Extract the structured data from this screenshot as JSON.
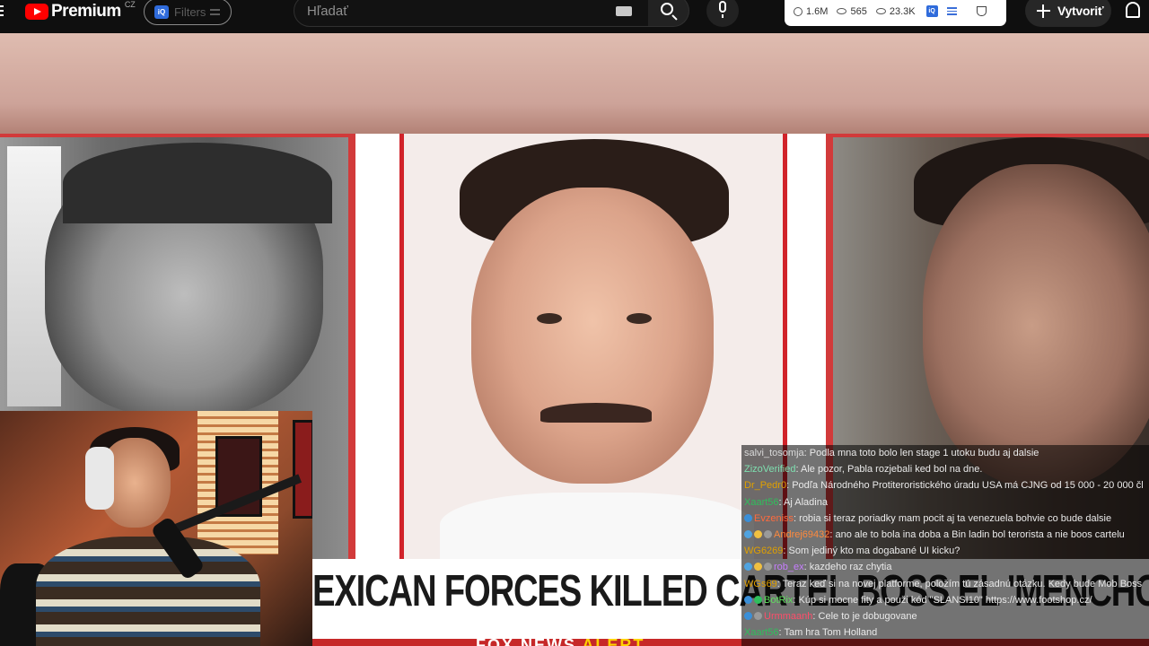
{
  "header": {
    "logo_text": "Premium",
    "logo_country": "CZ",
    "filters_badge": "iQ",
    "filters_label": "Filters",
    "search_placeholder": "Hľadať",
    "stats": {
      "subscribers": "1.6M",
      "views_a": "565",
      "views_b": "23.3K",
      "iq_badge": "iQ"
    },
    "create_label": "Vytvoriť"
  },
  "video": {
    "headline": "EXICAN FORCES KILLED CARTEL BOSS EL 'MENCHO'",
    "breaking_prefix": "FOX NEWS ",
    "breaking_suffix": "ALERT"
  },
  "chat": {
    "messages": [
      {
        "user": "salvi_tosomja",
        "color": "#d8d8d8",
        "text": "Podla mna toto bolo len stage 1 utoku budu aj dalsie",
        "badges": []
      },
      {
        "user": "ZizoVerified",
        "color": "#7ee0b0",
        "text": "Ale pozor, Pabla rozjebali ked bol na dne.",
        "badges": []
      },
      {
        "user": "Dr_Pedr0",
        "color": "#e0a000",
        "text": "Podľa Národného Protiteroristického úradu USA má CJNG od 15 000 - 20 000 čl",
        "badges": []
      },
      {
        "user": "Xaart56",
        "color": "#2fbf5c",
        "text": "Aj Aladina",
        "badges": []
      },
      {
        "user": "Evzeniss",
        "color": "#ff6a3d",
        "text": "robia si teraz poriadky mam pocit aj ta venezuela bohvie co bude dalsie",
        "badges": [
          "#3a8fd8"
        ]
      },
      {
        "user": "Andrej69432",
        "color": "#ff8a3d",
        "text": "ano ale to bola ina doba a Bin ladin bol terorista a nie boos cartelu",
        "badges": [
          "#4fa3e0",
          "#f0c040",
          "#9a9a9a"
        ]
      },
      {
        "user": "WG6269",
        "color": "#e0a000",
        "text": "Som jediný kto ma dogabané UI kicku?",
        "badges": []
      },
      {
        "user": "rob_ex",
        "color": "#c77dff",
        "text": "kazdeho raz chytia",
        "badges": [
          "#4fa3e0",
          "#f0c040",
          "#9a9a9a"
        ]
      },
      {
        "user": "WGs69",
        "color": "#e0a000",
        "text": "Teraz keď si na novej platforme, položím tú zásadnú otázku. Kedy bude Mob Boss",
        "badges": []
      },
      {
        "user": "BotRix",
        "color": "#5fe05f",
        "text": "Kúp si mocne fity a použi kód \"SLANSI10\" https://www.footshop.cz/",
        "badges": [
          "#3a8fd8",
          "#2fbf5c"
        ]
      },
      {
        "user": "Urmmaanh",
        "color": "#ff4d6a",
        "text": "Cele to je dobugovane",
        "badges": [
          "#3a8fd8",
          "#9a9a9a"
        ]
      },
      {
        "user": "Xaart56",
        "color": "#2fbf5c",
        "text": "Tam hra Tom Holland",
        "badges": []
      }
    ]
  },
  "colors": {
    "accent_red": "#ff0000",
    "iq_blue": "#2f6bdb",
    "headline_band": "#ffffff",
    "photo_frame_red": "#d1232a"
  },
  "icons": [
    "menu-icon",
    "youtube-logo-icon",
    "iq-icon",
    "sliders-icon",
    "keyboard-icon",
    "search-icon",
    "mic-icon",
    "subscribers-icon",
    "eye-icon",
    "list-icon",
    "trophy-icon",
    "plus-icon",
    "bell-icon"
  ]
}
